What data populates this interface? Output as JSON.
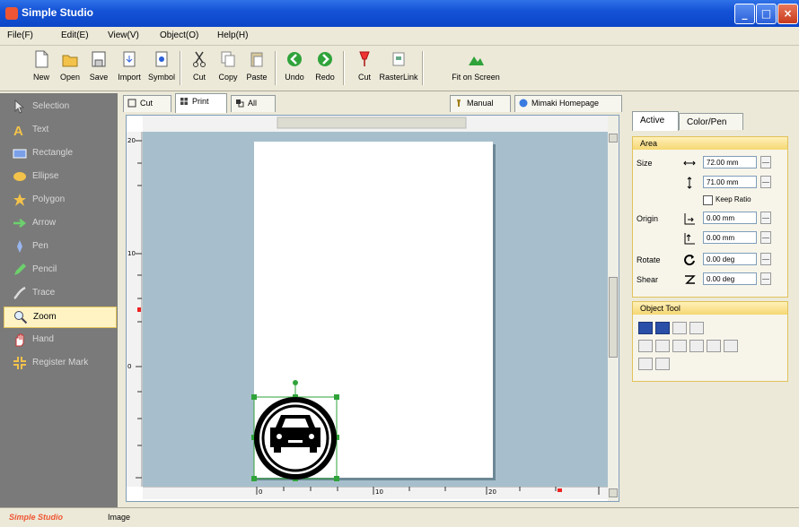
{
  "window": {
    "title": "Simple Studio"
  },
  "menu": [
    {
      "label": "File(F)"
    },
    {
      "label": "Edit(E)"
    },
    {
      "label": "View(V)"
    },
    {
      "label": "Object(O)"
    },
    {
      "label": "Help(H)"
    }
  ],
  "toolbar": [
    {
      "label": "New",
      "icon": "new-document-icon"
    },
    {
      "label": "Open",
      "icon": "folder-open-icon"
    },
    {
      "label": "Save",
      "icon": "save-disk-icon"
    },
    {
      "label": "Import",
      "icon": "import-icon"
    },
    {
      "label": "Symbol",
      "icon": "symbol-icon"
    },
    {
      "label": "Cut",
      "icon": "scissors-icon"
    },
    {
      "label": "Copy",
      "icon": "copy-icon"
    },
    {
      "label": "Paste",
      "icon": "paste-icon"
    },
    {
      "label": "Undo",
      "icon": "undo-icon"
    },
    {
      "label": "Redo",
      "icon": "redo-icon"
    },
    {
      "label": "Cut",
      "icon": "cutter-icon"
    },
    {
      "label": "RasterLink",
      "icon": "rasterlink-icon"
    },
    {
      "label": "Fit on Screen",
      "icon": "fit-screen-icon"
    }
  ],
  "tools": [
    {
      "label": "Selection",
      "icon": "arrow-pointer-icon"
    },
    {
      "label": "Text",
      "icon": "text-icon"
    },
    {
      "label": "Rectangle",
      "icon": "rectangle-icon"
    },
    {
      "label": "Ellipse",
      "icon": "ellipse-icon"
    },
    {
      "label": "Polygon",
      "icon": "star-icon"
    },
    {
      "label": "Arrow",
      "icon": "arrow-right-icon"
    },
    {
      "label": "Pen",
      "icon": "pen-icon"
    },
    {
      "label": "Pencil",
      "icon": "pencil-icon"
    },
    {
      "label": "Trace",
      "icon": "trace-icon"
    },
    {
      "label": "Zoom",
      "icon": "magnifier-icon",
      "active": true
    },
    {
      "label": "Hand",
      "icon": "hand-icon"
    },
    {
      "label": "Register Mark",
      "icon": "register-mark-icon"
    }
  ],
  "doc_tabs": [
    {
      "label": "Cut",
      "icon": "cut-tab-icon"
    },
    {
      "label": "Print",
      "icon": "print-tab-icon",
      "active": true
    },
    {
      "label": "All",
      "icon": "all-tab-icon"
    }
  ],
  "link_tabs": [
    {
      "label": "Manual",
      "icon": "manual-icon"
    },
    {
      "label": "Mimaki Homepage",
      "icon": "globe-icon"
    }
  ],
  "right_tabs": [
    {
      "label": "Active",
      "active": true
    },
    {
      "label": "Color/Pen"
    }
  ],
  "area": {
    "title": "Area",
    "size_label": "Size",
    "width": "72.00 mm",
    "height": "71.00 mm",
    "keep_ratio": "Keep Ratio",
    "origin_label": "Origin",
    "origin_x": "0.00 mm",
    "origin_y": "0.00 mm",
    "rotate_label": "Rotate",
    "rotate": "0.00 deg",
    "shear_label": "Shear",
    "shear": "0.00 deg"
  },
  "object_tool": {
    "title": "Object Tool"
  },
  "ruler": {
    "h_labels": [
      "0",
      "10",
      "20"
    ],
    "v_labels": [
      "20",
      "10",
      "0"
    ]
  },
  "status": {
    "brand": "Simple Studio",
    "text": "Image"
  },
  "colors": {
    "accent": "#e1c25a",
    "canvas": "#a7bfcc",
    "title": "#0b46c7"
  }
}
